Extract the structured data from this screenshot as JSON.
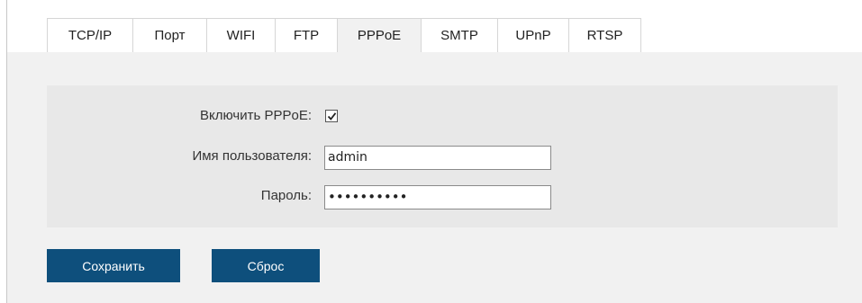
{
  "tabs": [
    {
      "label": "TCP/IP",
      "active": false
    },
    {
      "label": "Порт",
      "active": false
    },
    {
      "label": "WIFI",
      "active": false
    },
    {
      "label": "FTP",
      "active": false
    },
    {
      "label": "PPPoE",
      "active": true
    },
    {
      "label": "SMTP",
      "active": false
    },
    {
      "label": "UPnP",
      "active": false
    },
    {
      "label": "RTSP",
      "active": false
    }
  ],
  "form": {
    "enable_label": "Включить PPPoE:",
    "enable_checked": true,
    "username_label": "Имя пользователя:",
    "username_value": "admin",
    "password_label": "Пароль:",
    "password_value": "••••••••••"
  },
  "buttons": {
    "save_label": "Сохранить",
    "reset_label": "Сброс"
  },
  "colors": {
    "button_bg": "#0e4f7c",
    "panel_bg": "#f1f1f1",
    "form_bg": "#e8e8e8"
  }
}
